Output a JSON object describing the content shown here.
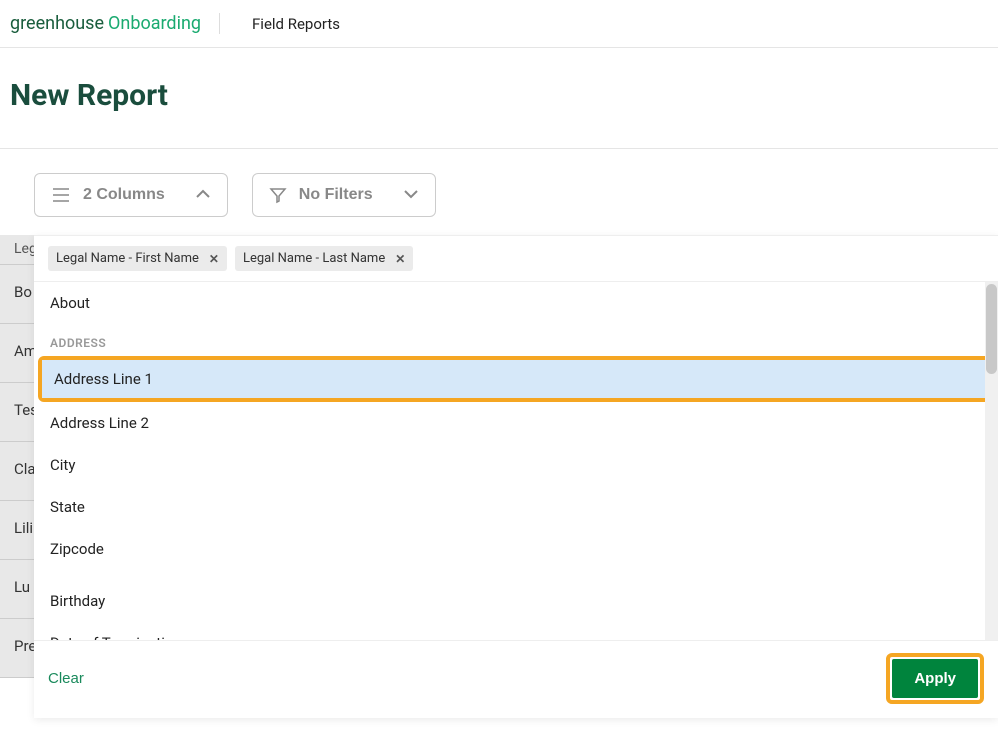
{
  "header": {
    "logo_part1": "greenhouse",
    "logo_part2": "Onboarding",
    "nav_field_reports": "Field Reports"
  },
  "page": {
    "title": "New Report"
  },
  "controls": {
    "columns_label": "2 Columns",
    "filters_label": "No Filters"
  },
  "background_rows": {
    "header": "Leg",
    "rows": [
      "Bo",
      "Am",
      "Tes",
      "Cla",
      "Lili",
      "Lu",
      "Pre"
    ]
  },
  "dropdown": {
    "tags": [
      {
        "label": "Legal Name - First Name"
      },
      {
        "label": "Legal Name - Last Name"
      }
    ],
    "items": {
      "about": "About",
      "section_address": "ADDRESS",
      "address1": "Address Line 1",
      "address2": "Address Line 2",
      "city": "City",
      "state": "State",
      "zipcode": "Zipcode",
      "birthday": "Birthday",
      "date_termination": "Date of Termination"
    },
    "clear_label": "Clear",
    "apply_label": "Apply"
  }
}
